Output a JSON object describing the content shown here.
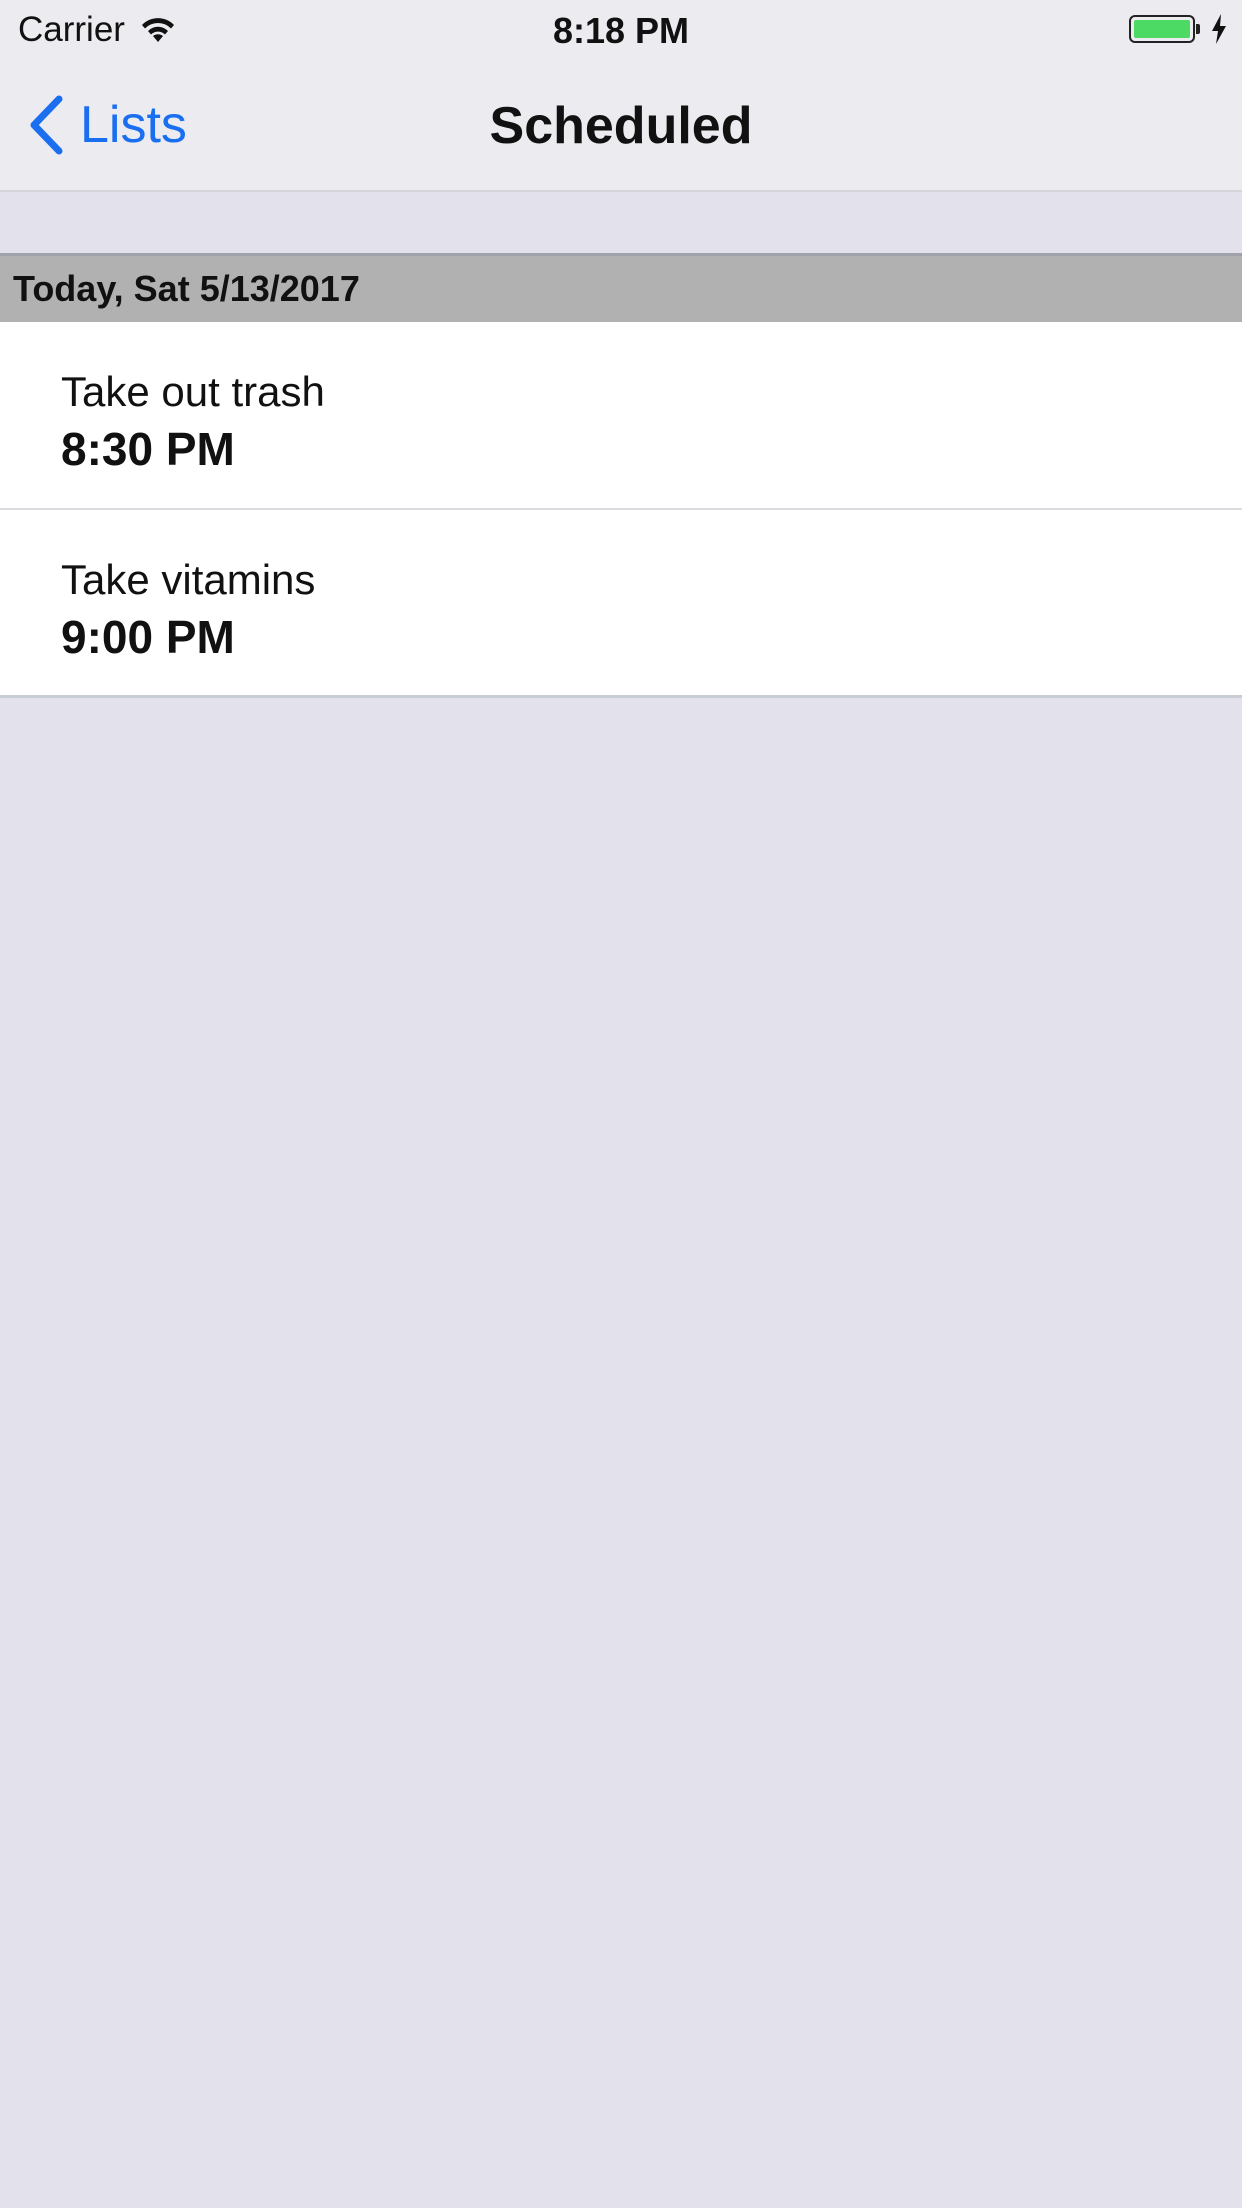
{
  "status_bar": {
    "carrier": "Carrier",
    "time": "8:18 PM",
    "battery_level": 1.0,
    "battery_color": "#4cd964",
    "charging": true,
    "icons": [
      "wifi-icon",
      "battery-icon",
      "charging-bolt-icon"
    ]
  },
  "nav": {
    "back_label": "Lists",
    "back_icon": "chevron-left-icon",
    "title": "Scheduled",
    "accent_color": "#1a6ff0"
  },
  "section": {
    "header": "Today, Sat 5/13/2017",
    "items": [
      {
        "title": "Take out trash",
        "time": "8:30 PM"
      },
      {
        "title": "Take vitamins",
        "time": "9:00 PM"
      }
    ]
  }
}
